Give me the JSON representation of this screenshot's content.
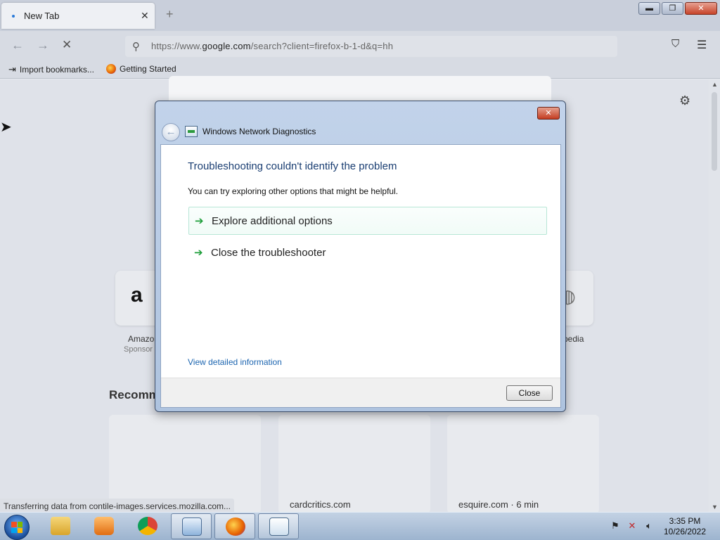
{
  "browser": {
    "tab_title": "New Tab",
    "tab_close": "✕",
    "new_tab": "+",
    "url_prefix": "https://www.",
    "url_domain": "google.com",
    "url_suffix": "/search?client=firefox-b-1-d&q=hh",
    "bookmarks": [
      "Import bookmarks...",
      "Getting Started"
    ],
    "window_buttons": {
      "minimize": "▬",
      "maximize": "❐",
      "close": "✕"
    }
  },
  "page": {
    "shortcuts": [
      {
        "label": "Amazo",
        "sub": "Sponsor"
      },
      {
        "label": "pedia",
        "sub": ""
      }
    ],
    "recommended_title": "Recomm",
    "cards": [
      "cardcritics.com",
      "esquire.com · 6 min"
    ],
    "status_text": "Transferring data from contile-images.services.mozilla.com..."
  },
  "dialog": {
    "title": "Windows Network Diagnostics",
    "heading": "Troubleshooting couldn't identify the problem",
    "description": "You can try exploring other options that might be helpful.",
    "options": [
      "Explore additional options",
      "Close the troubleshooter"
    ],
    "details_link": "View detailed information",
    "close_button": "Close",
    "title_close": "✕"
  },
  "taskbar": {
    "time": "3:35 PM",
    "date": "10/26/2022"
  },
  "colors": {
    "heading": "#1a3e72",
    "link": "#1c65b0",
    "arrow": "#1e9e3a"
  }
}
